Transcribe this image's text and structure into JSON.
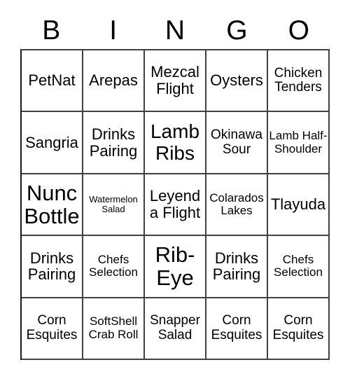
{
  "card": {
    "title_letters": [
      "B",
      "I",
      "N",
      "G",
      "O"
    ],
    "columns": 5,
    "rows": 5,
    "border_color": "#404040",
    "text_color": "#000000",
    "background_color": "#ffffff",
    "cells": [
      {
        "text": "PetNat",
        "size": "md"
      },
      {
        "text": "Arepas",
        "size": "md"
      },
      {
        "text": "Mezcal Flight",
        "size": "md"
      },
      {
        "text": "Oysters",
        "size": "md"
      },
      {
        "text": "Chicken Tenders",
        "size": "sm"
      },
      {
        "text": "Sangria",
        "size": "md"
      },
      {
        "text": "Drinks Pairing",
        "size": "md"
      },
      {
        "text": "Lamb Ribs",
        "size": "lg"
      },
      {
        "text": "Okinawa Sour",
        "size": "sm"
      },
      {
        "text": "Lamb Half-Shoulder",
        "size": "xs"
      },
      {
        "text": "Nunc Bottle",
        "size": "xl"
      },
      {
        "text": "Watermelon Salad",
        "size": "tiny"
      },
      {
        "text": "Leyenda Flight",
        "size": "md"
      },
      {
        "text": "Colarados Lakes",
        "size": "xs"
      },
      {
        "text": "Tlayuda",
        "size": "md"
      },
      {
        "text": "Drinks Pairing",
        "size": "md"
      },
      {
        "text": "Chefs Selection",
        "size": "xs"
      },
      {
        "text": "Rib-Eye",
        "size": "xl"
      },
      {
        "text": "Drinks Pairing",
        "size": "md"
      },
      {
        "text": "Chefs Selection",
        "size": "xs"
      },
      {
        "text": "Corn Esquites",
        "size": "sm"
      },
      {
        "text": "SoftShell Crab Roll",
        "size": "xs"
      },
      {
        "text": "Snapper Salad",
        "size": "sm"
      },
      {
        "text": "Corn Esquites",
        "size": "sm"
      },
      {
        "text": "Corn Esquites",
        "size": "sm"
      }
    ]
  }
}
